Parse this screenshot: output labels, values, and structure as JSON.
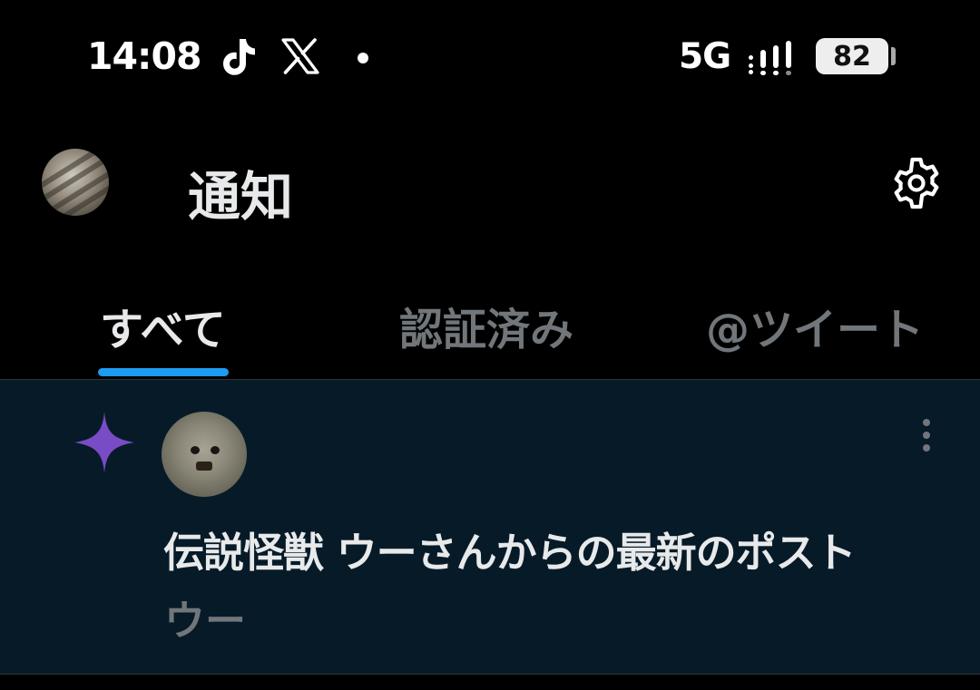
{
  "status_bar": {
    "time": "14:08",
    "network": "5G",
    "battery": "82",
    "app_icons": [
      "tiktok-icon",
      "x-icon"
    ]
  },
  "header": {
    "title": "通知",
    "settings_icon": "gear-icon"
  },
  "tabs": [
    {
      "label": "すべて",
      "active": true
    },
    {
      "label": "認証済み",
      "active": false
    },
    {
      "label": "@ツイート",
      "active": false
    }
  ],
  "notification": {
    "icon": "sparkle-icon",
    "title": "伝説怪獣 ウーさんからの最新のポスト",
    "preview": "ウー"
  },
  "colors": {
    "background": "#000000",
    "accent": "#1d9bf0",
    "sparkle": "#794bc4",
    "notification_bg": "#071a27",
    "muted_text": "#71767b",
    "primary_text": "#e7e9ea"
  }
}
